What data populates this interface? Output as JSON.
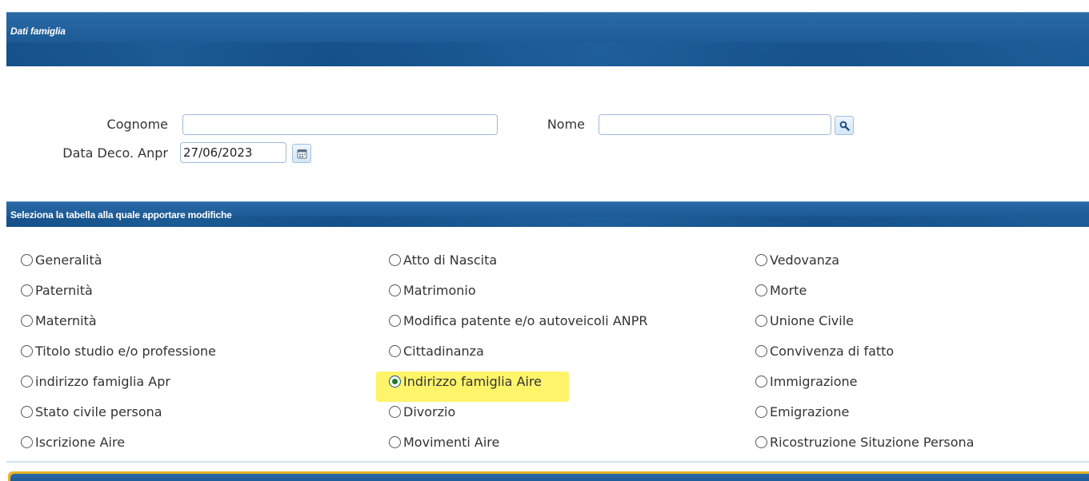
{
  "panels": {
    "dati_famiglia_title": "Dati famiglia",
    "selection_title": "Seleziona la tabella alla quale apportare modifiche"
  },
  "form": {
    "cognome_label": "Cognome",
    "cognome_value": "",
    "nome_label": "Nome",
    "nome_value": "",
    "data_deco_label": "Data Deco. Anpr",
    "data_deco_value": "27/06/2023"
  },
  "icons": {
    "search": "search-icon",
    "calendar": "calendar-icon"
  },
  "colors": {
    "header_blue": "#1e5c98",
    "highlight_yellow": "#fff46a",
    "selected_dot": "#1f7a2c"
  },
  "options": {
    "col1": [
      "Generalità",
      "Paternità",
      "Maternità",
      "Titolo studio e/o professione",
      "indirizzo famiglia Apr",
      "Stato civile persona",
      "Iscrizione Aire"
    ],
    "col2": [
      "Atto di Nascita",
      "Matrimonio",
      "Modifica patente e/o autoveicoli ANPR",
      "Cittadinanza",
      "Indirizzo famiglia Aire",
      "Divorzio",
      "Movimenti Aire"
    ],
    "col3": [
      "Vedovanza",
      "Morte",
      "Unione Civile",
      "Convivenza di fatto",
      "Immigrazione",
      "Emigrazione",
      "Ricostruzione Situzione Persona"
    ],
    "selected": "Indirizzo famiglia Aire"
  }
}
